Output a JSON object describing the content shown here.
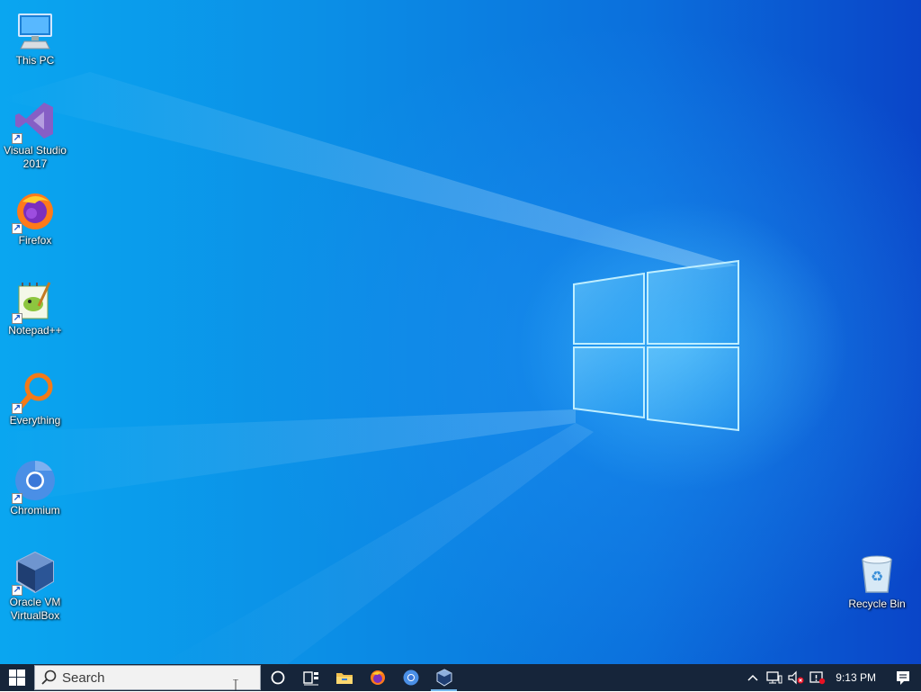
{
  "desktop": {
    "icons": [
      {
        "label": "This PC",
        "icon": "computer-icon"
      },
      {
        "label": "Visual Studio 2017",
        "icon": "visual-studio-icon"
      },
      {
        "label": "Firefox",
        "icon": "firefox-icon"
      },
      {
        "label": "Notepad++",
        "icon": "notepadpp-icon"
      },
      {
        "label": "Everything",
        "icon": "everything-search-icon"
      },
      {
        "label": "Chromium",
        "icon": "chromium-icon"
      },
      {
        "label": "Oracle VM VirtualBox",
        "icon": "virtualbox-icon"
      },
      {
        "label": "Recycle Bin",
        "icon": "recycle-bin-icon"
      }
    ]
  },
  "taskbar": {
    "search_placeholder": "Search",
    "pinned": [
      "cortana-icon",
      "task-view-icon",
      "file-explorer-icon",
      "firefox-icon",
      "chromium-icon",
      "virtualbox-icon"
    ],
    "active_app": "virtualbox-icon",
    "tray": {
      "icons": [
        "chevron-up-icon",
        "network-icon",
        "volume-muted-icon",
        "alert-icon"
      ],
      "time": "9:13 PM"
    }
  },
  "colors": {
    "taskbar": "#16253a",
    "accent": "#76b9ed"
  }
}
